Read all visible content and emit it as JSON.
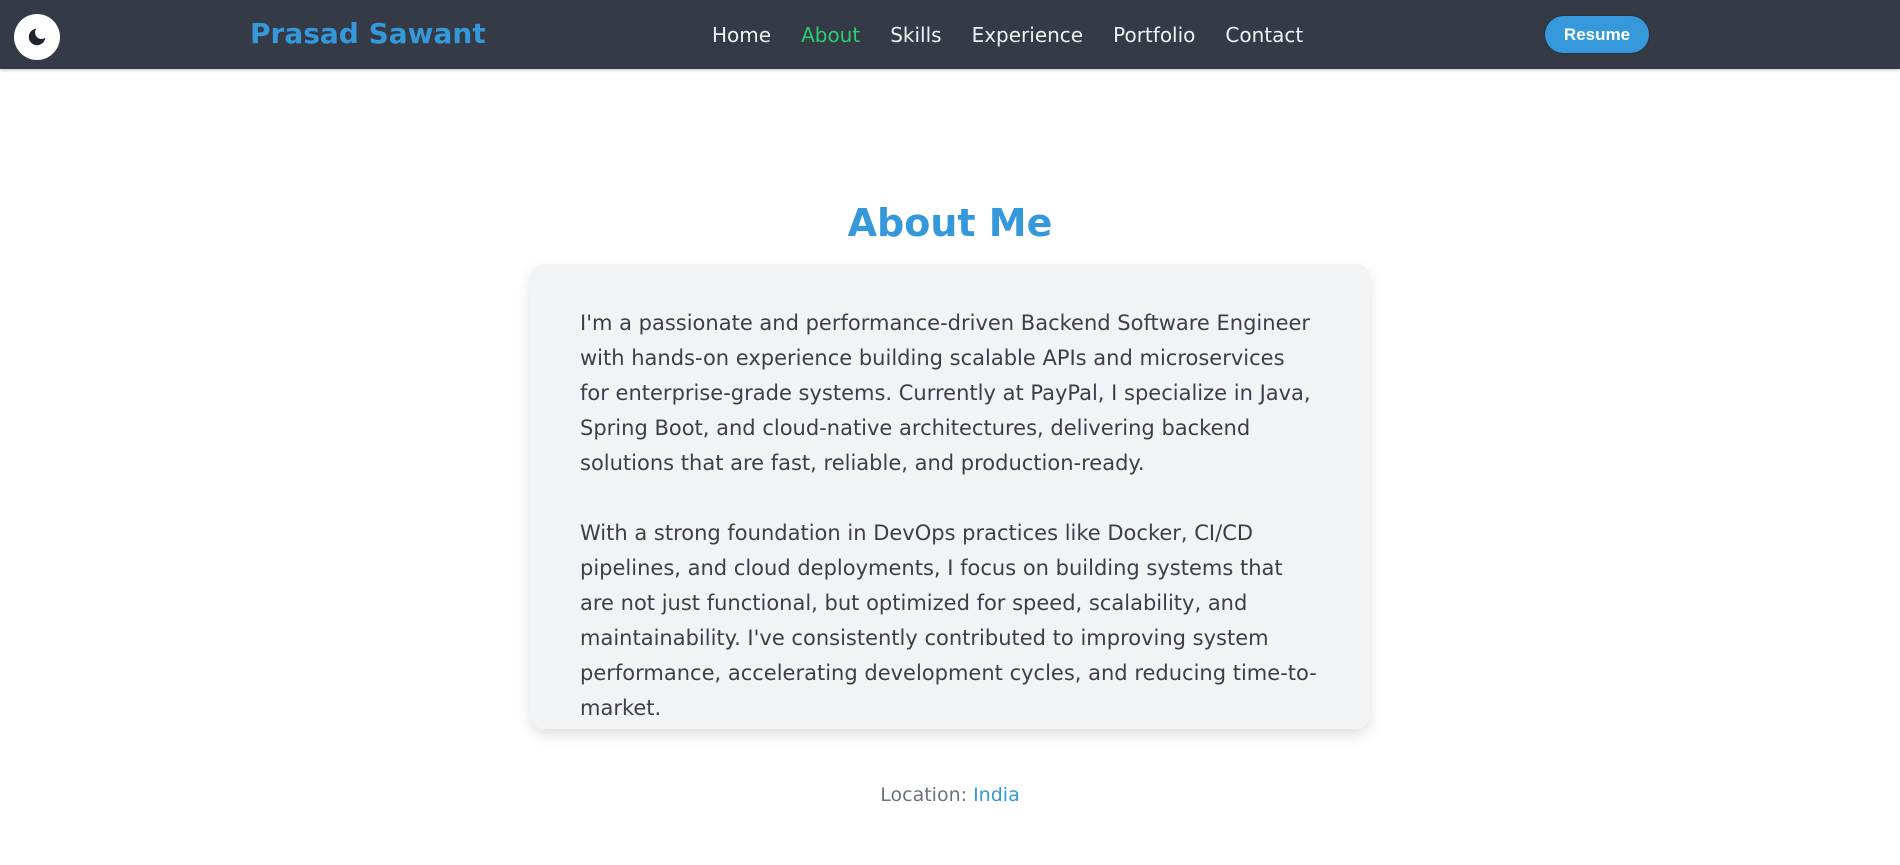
{
  "header": {
    "theme_icon": "moon-icon",
    "brand": "Prasad Sawant",
    "nav": [
      {
        "label": "Home",
        "active": false
      },
      {
        "label": "About",
        "active": true
      },
      {
        "label": "Skills",
        "active": false
      },
      {
        "label": "Experience",
        "active": false
      },
      {
        "label": "Portfolio",
        "active": false
      },
      {
        "label": "Contact",
        "active": false
      }
    ],
    "resume_label": "Resume"
  },
  "about": {
    "title": "About Me",
    "paragraphs": [
      "I'm a passionate and performance-driven Backend Software Engineer with hands-on experience building scalable APIs and microservices for enterprise-grade systems. Currently at PayPal, I specialize in Java, Spring Boot, and cloud-native architectures, delivering backend solutions that are fast, reliable, and production-ready.",
      "With a strong foundation in DevOps practices like Docker, CI/CD pipelines, and cloud deployments, I focus on building systems that are not just functional, but optimized for speed, scalability, and maintainability. I've consistently contributed to improving system performance, accelerating development cycles, and reducing time-to-market."
    ],
    "location_label": "Location:",
    "location_value": "India"
  },
  "colors": {
    "navbar_bg": "#343a46",
    "accent": "#3498db",
    "active_nav": "#2ecc71",
    "card_bg": "#f2f3f5"
  }
}
